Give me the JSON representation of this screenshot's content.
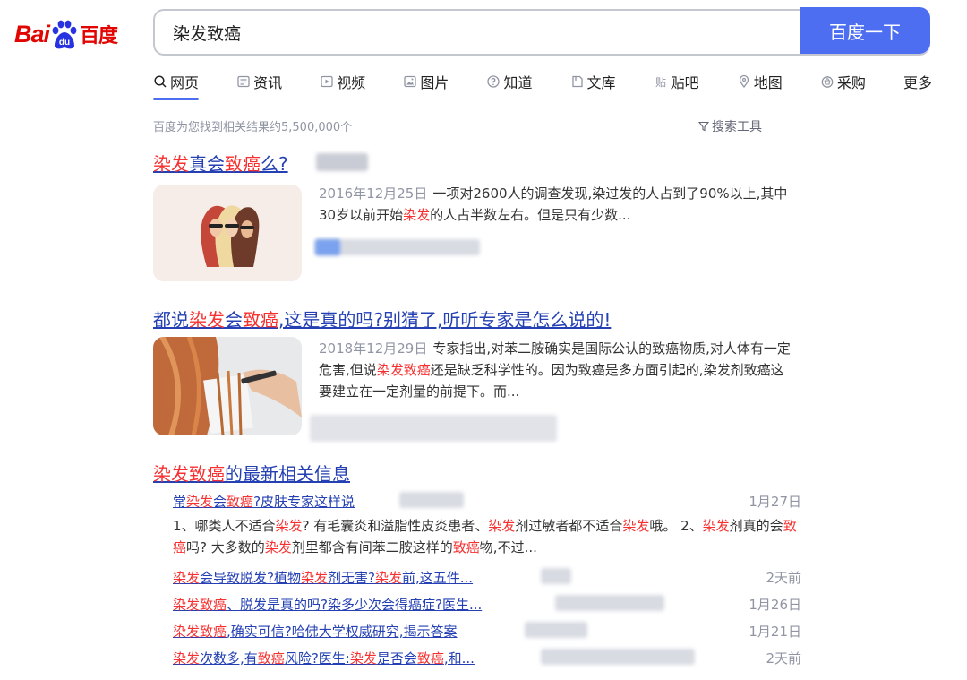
{
  "logo": {
    "bai": "Bai",
    "du": "du",
    "cn": "百度"
  },
  "search": {
    "query": "染发致癌",
    "button_label": "百度一下"
  },
  "tabs": [
    {
      "label": "网页",
      "icon": "search-icon"
    },
    {
      "label": "资讯",
      "icon": "news-icon"
    },
    {
      "label": "视频",
      "icon": "video-icon"
    },
    {
      "label": "图片",
      "icon": "image-icon"
    },
    {
      "label": "知道",
      "icon": "question-icon"
    },
    {
      "label": "文库",
      "icon": "document-icon"
    },
    {
      "label": "贴吧",
      "icon": "tieba-icon"
    },
    {
      "label": "地图",
      "icon": "map-icon"
    },
    {
      "label": "采购",
      "icon": "shopping-icon"
    },
    {
      "label": "更多",
      "icon": ""
    }
  ],
  "result_count": "百度为您找到相关结果约5,500,000个",
  "search_tools": "搜索工具",
  "results": [
    {
      "title": [
        [
          "染发",
          true
        ],
        [
          "真会",
          false
        ],
        [
          "致癌",
          true
        ],
        [
          "么?",
          false
        ]
      ],
      "date": "2016年12月25日",
      "abstract": [
        [
          "一项对2600人的调查发现,染过发的人占到了90%以上,其中30岁以前开始",
          false
        ],
        [
          "染发",
          true
        ],
        [
          "的人占半数左右。但是只有少数...",
          false
        ]
      ]
    },
    {
      "title": [
        [
          "都说",
          false
        ],
        [
          "染发",
          true
        ],
        [
          "会",
          false
        ],
        [
          "致癌",
          true
        ],
        [
          ",这是真的吗?别猜了,听听专家是怎么说的!",
          false
        ]
      ],
      "date": "2018年12月29日",
      "abstract": [
        [
          "专家指出,对苯二胺确实是国际公认的致癌物质,对人体有一定危害,但说",
          false
        ],
        [
          "染发致癌",
          true
        ],
        [
          "还是缺乏科学性的。因为致癌是多方面引起的,染发剂致癌这要建立在一定剂量的前提下。而...",
          false
        ]
      ]
    }
  ],
  "news": {
    "title": [
      [
        "染发致癌",
        true
      ],
      [
        "的最新相关信息",
        false
      ]
    ],
    "top": {
      "link": [
        [
          "常",
          false
        ],
        [
          "染发",
          true
        ],
        [
          "会",
          false
        ],
        [
          "致癌",
          true
        ],
        [
          "?皮肤专家这样说",
          false
        ]
      ],
      "time": "1月27日",
      "abstract": [
        [
          "1、哪类人不适合",
          false
        ],
        [
          "染发",
          true
        ],
        [
          "? 有毛囊炎和溢脂性皮炎患者、",
          false
        ],
        [
          "染发",
          true
        ],
        [
          "剂过敏者都不适合",
          false
        ],
        [
          "染发",
          true
        ],
        [
          "哦。 2、",
          false
        ],
        [
          "染发",
          true
        ],
        [
          "剂真的会",
          false
        ],
        [
          "致癌",
          true
        ],
        [
          "吗? 大多数的",
          false
        ],
        [
          "染发",
          true
        ],
        [
          "剂里都含有间苯二胺这样的",
          false
        ],
        [
          "致癌",
          true
        ],
        [
          "物,不过...",
          false
        ]
      ]
    },
    "items": [
      {
        "link": [
          [
            "染发",
            true
          ],
          [
            "会导致脱发?植物",
            false
          ],
          [
            "染发",
            true
          ],
          [
            "剂无害?",
            false
          ],
          [
            "染发",
            true
          ],
          [
            "前,这五件...",
            false
          ]
        ],
        "time": "2天前"
      },
      {
        "link": [
          [
            "染发致癌",
            true
          ],
          [
            "、脱发是真的吗?染多少次会得癌症?医生...",
            false
          ]
        ],
        "time": "1月26日"
      },
      {
        "link": [
          [
            "染发致癌",
            true
          ],
          [
            ",确实可信?哈佛大学权威研究,揭示答案",
            false
          ]
        ],
        "time": "1月21日"
      },
      {
        "link": [
          [
            "染发",
            true
          ],
          [
            "次数多,有",
            false
          ],
          [
            "致癌",
            true
          ],
          [
            "风险?医生:",
            false
          ],
          [
            "染发",
            true
          ],
          [
            "是否会",
            false
          ],
          [
            "致癌",
            true
          ],
          [
            ",和...",
            false
          ]
        ],
        "time": "2天前"
      }
    ]
  }
}
